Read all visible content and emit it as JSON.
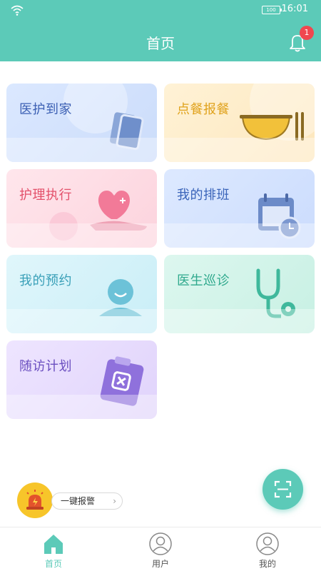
{
  "status": {
    "battery": "100",
    "time": "16:01"
  },
  "header": {
    "title": "首页",
    "notification_count": "1"
  },
  "cards": [
    {
      "label": "医护到家",
      "color": "#3b5fb3"
    },
    {
      "label": "点餐报餐",
      "color": "#e0a21c"
    },
    {
      "label": "护理执行",
      "color": "#e3506a"
    },
    {
      "label": "我的排班",
      "color": "#3a64b9"
    },
    {
      "label": "我的预约",
      "color": "#3aa0b8"
    },
    {
      "label": "医生巡诊",
      "color": "#2fa98d"
    },
    {
      "label": "随访计划",
      "color": "#6b4fc0"
    }
  ],
  "alarm": {
    "label": "一键报警"
  },
  "tabs": [
    {
      "label": "首页",
      "icon": "home-icon",
      "active": true
    },
    {
      "label": "用户",
      "icon": "user-icon",
      "active": false
    },
    {
      "label": "我的",
      "icon": "profile-icon",
      "active": false
    }
  ],
  "colors": {
    "primary": "#5ccab8",
    "badge": "#f0474f",
    "alarm": "#f7c52a"
  }
}
